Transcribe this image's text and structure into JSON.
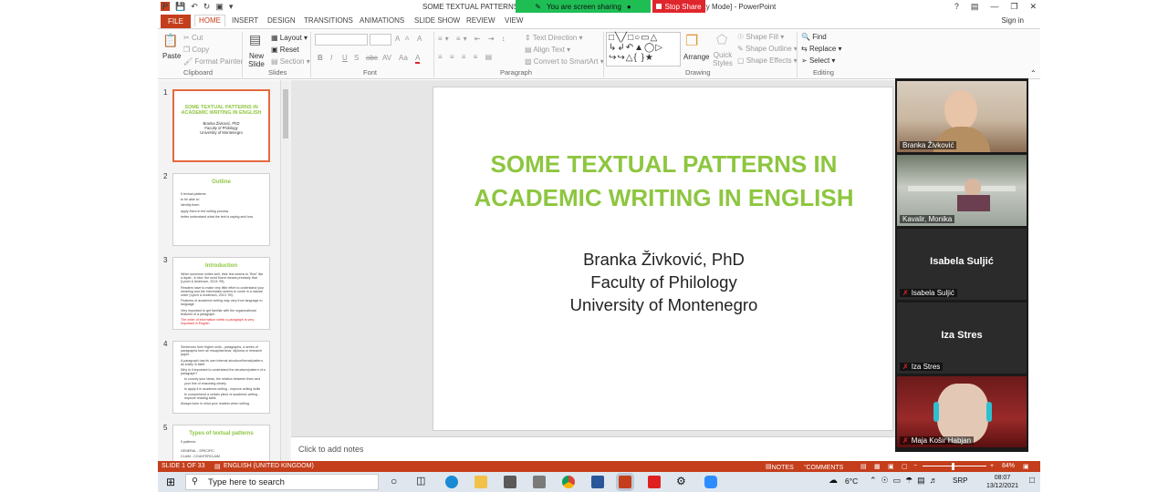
{
  "window": {
    "title_left": "SOME TEXTUAL PATTERNS IN",
    "title_right": "lity Mode] - PowerPoint",
    "help": "?",
    "sign_in": "Sign in"
  },
  "sharing": {
    "status": "You are screen sharing",
    "stop_label": "Stop Share",
    "green": "#1fbe55",
    "red": "#e0262d"
  },
  "tabs": [
    "FILE",
    "HOME",
    "INSERT",
    "DESIGN",
    "TRANSITIONS",
    "ANIMATIONS",
    "SLIDE SHOW",
    "REVIEW",
    "VIEW"
  ],
  "ribbon": {
    "clipboard": {
      "paste": "Paste",
      "cut": "Cut",
      "copy": "Copy",
      "format_painter": "Format Painter",
      "label": "Clipboard"
    },
    "slides": {
      "new_slide": "New Slide",
      "layout": "Layout",
      "reset": "Reset",
      "section": "Section",
      "label": "Slides"
    },
    "font": {
      "label": "Font",
      "bold": "B",
      "italic": "I",
      "underline": "U",
      "strike": "S",
      "abc": "abc",
      "spacing": "AV",
      "case": "Aa",
      "color": "A",
      "grow": "A",
      "shrink": "A",
      "clear": "A"
    },
    "paragraph": {
      "text_direction": "Text Direction",
      "align_text": "Align Text",
      "smartart": "Convert to SmartArt",
      "label": "Paragraph"
    },
    "drawing": {
      "arrange": "Arrange",
      "quick_styles": "Quick Styles",
      "shape_fill": "Shape Fill",
      "shape_outline": "Shape Outline",
      "shape_effects": "Shape Effects",
      "label": "Drawing"
    },
    "editing": {
      "find": "Find",
      "replace": "Replace",
      "select": "Select",
      "label": "Editing"
    }
  },
  "thumbnails": [
    {
      "num": "1",
      "title": "SOME TEXTUAL PATTERNS IN ACADEMIC WRITING IN ENGLISH",
      "lines": [
        "Branka Živković, PhD",
        "Faculty of Philology",
        "University of Montenegro"
      ]
    },
    {
      "num": "2",
      "title": "Outline",
      "lines": [
        "5 textual patterns",
        "to be able to:",
        "identify them",
        "apply them in the writing process",
        "better understand what the text is saying and how"
      ]
    },
    {
      "num": "3",
      "title": "Introduction",
      "lines": [
        "When someone writes well, their text seems to \"flow\" like a liquid - in fact, the word fluent means precisely that (Lynch & Anderson, 2013: 99).",
        "Readers have to make very little effort to understand your meaning and the information seems to come in a natural order (Lynch & Anderson, 2013: 99).",
        "Features of academic writing may vary from language to language",
        "Very important to get familiar with the organizational features of a paragraph",
        "The order of information within a paragraph is very important in English"
      ]
    },
    {
      "num": "4",
      "title": "",
      "lines": [
        "Sentences form higher units - paragraphs, a series of paragraphs form an essay/seminar, diploma or research paper.",
        "A paragraph has its own internal structure/format/pattern, as solely in itself.",
        "Why is it important to understand the structure/pattern of a paragraph?",
        "to convey your ideas, the relation between them and your line of reasoning clearly",
        "to apply it in academic writing - improve writing skills",
        "to comprehend a certain piece of academic writing - improve reading skills",
        "Always have in mind your readers when writing."
      ]
    },
    {
      "num": "5",
      "title": "Types of textual patterns",
      "lines": [
        "5 patterns:",
        "GENERAL - SPECIFIC",
        "CLAIM - COUNTERCLAIM"
      ]
    }
  ],
  "slide": {
    "title": "SOME TEXTUAL PATTERNS IN ACADEMIC WRITING IN ENGLISH",
    "author": "Branka Živković, PhD",
    "faculty": "Faculty of Philology",
    "university": "University of Montenegro",
    "title_color": "#8dc63f"
  },
  "notes_placeholder": "Click to add notes",
  "participants": [
    {
      "name": "Branka Živković",
      "video": true
    },
    {
      "name": "Kavalir, Monika",
      "video": true
    },
    {
      "name": "Isabela Suljić",
      "video": false,
      "muted": true
    },
    {
      "name": "Iza Stres",
      "video": false,
      "muted": true
    },
    {
      "name": "Maja Košir Habjan",
      "video": true,
      "muted": true
    }
  ],
  "statusbar": {
    "slide_info": "SLIDE 1 OF 33",
    "language": "ENGLISH (UNITED KINGDOM)",
    "notes": "NOTES",
    "comments": "COMMENTS",
    "zoom": "84%",
    "zoom_out": "−",
    "zoom_in": "+"
  },
  "taskbar": {
    "search_placeholder": "Type here to search",
    "temperature": "6°C",
    "lang": "SRP",
    "time": "08:07",
    "date": "13/12/2021"
  }
}
